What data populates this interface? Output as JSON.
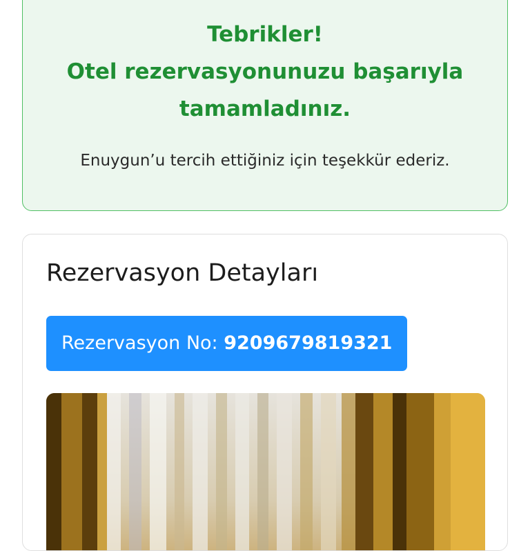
{
  "success": {
    "line1": "Tebrikler!",
    "line2": "Otel rezervasyonunuzu başarıyla",
    "line3": "tamamladınız.",
    "thanks": "Enuygun’u tercih ettiğiniz için teşekkür ederiz.",
    "accent_color": "#1f8f34",
    "background_color": "#ecf7ee"
  },
  "details": {
    "title": "Rezervasyon Detayları",
    "reservation_label": "Rezervasyon No:",
    "reservation_number": "9209679819321",
    "badge_color": "#1e90ff"
  }
}
